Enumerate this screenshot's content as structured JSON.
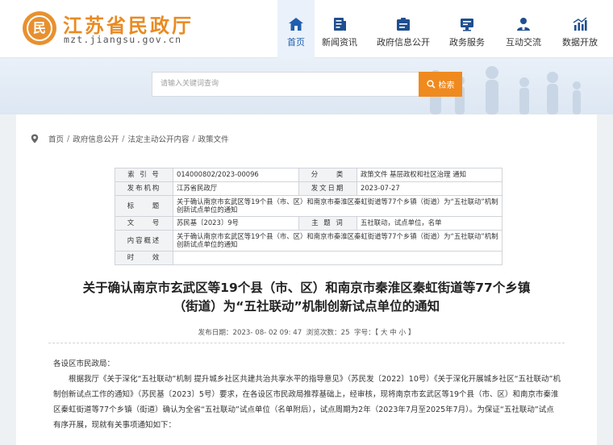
{
  "site": {
    "title": "江苏省民政厅",
    "domain": "mzt.jiangsu.gov.cn",
    "emblem_glyph": "民"
  },
  "nav": [
    {
      "label": "首页",
      "icon": "home-icon",
      "active": true
    },
    {
      "label": "新闻资讯",
      "icon": "news-icon"
    },
    {
      "label": "政府信息公开",
      "icon": "info-disclosure-icon"
    },
    {
      "label": "政务服务",
      "icon": "service-icon"
    },
    {
      "label": "互动交流",
      "icon": "interaction-icon"
    },
    {
      "label": "数据开放",
      "icon": "chart-icon"
    }
  ],
  "search": {
    "placeholder": "请输入关键词查询",
    "button_label": "检索"
  },
  "breadcrumb": [
    "首页",
    "政府信息公开",
    "法定主动公开内容",
    "政策文件"
  ],
  "meta": {
    "index_label": "索 引 号",
    "index_value": "014000802/2023-00096",
    "category_label": "分　　类",
    "category_value": "政策文件 基层政权和社区治理 通知",
    "issuer_label": "发布机构",
    "issuer_value": "江苏省民政厅",
    "date_label": "发文日期",
    "date_value": "2023-07-27",
    "title_label": "标　　题",
    "title_value": "关于确认南京市玄武区等19个县（市、区）和南京市秦淮区秦虹街道等77个乡镇（街道）为“五社联动”机制创新试点单位的通知",
    "docno_label": "文　　号",
    "docno_value": "苏民基〔2023〕9号",
    "keywords_label": "主 题 词",
    "keywords_value": "五社联动，试点单位，名单",
    "summary_label": "内容概述",
    "summary_value": "关于确认南京市玄武区等19个县（市、区）和南京市秦淮区秦虹街道等77个乡镇（街道）为“五社联动”机制创新试点单位的通知",
    "validity_label": "时　　效",
    "validity_value": ""
  },
  "article": {
    "title_line1": "关于确认南京市玄武区等19个县（市、区）和南京市秦淮区秦虹街道等77个乡镇",
    "title_line2": "（街道）为“五社联动”机制创新试点单位的通知",
    "publish_label": "发布日期：",
    "publish_time": "2023- 08- 02 09: 47",
    "views_label": "浏览次数：",
    "views": "25",
    "font_label": "字号：",
    "font_options": "【 大 中 小 】",
    "salutation": "各设区市民政局：",
    "paragraph": "根据我厅《关于深化“五社联动”机制 提升城乡社区共建共治共享水平的指导意见》（苏民发〔2022〕10号）《关于深化开展城乡社区“五社联动”机制创新试点工作的通知》（苏民基〔2023〕5号）要求，在各设区市民政局推荐基础上，经审核，现将南京市玄武区等19个县（市、区）和南京市秦淮区秦虹街道等77个乡镇（街道）确认为全省“五社联动”试点单位（名单附后），试点周期为2年（2023年7月至2025年7月）。为保证“五社联动”试点有序开展，现就有关事项通知如下："
  },
  "colors": {
    "brand_orange": "#ef8a1f",
    "nav_active": "#1f5fad"
  }
}
